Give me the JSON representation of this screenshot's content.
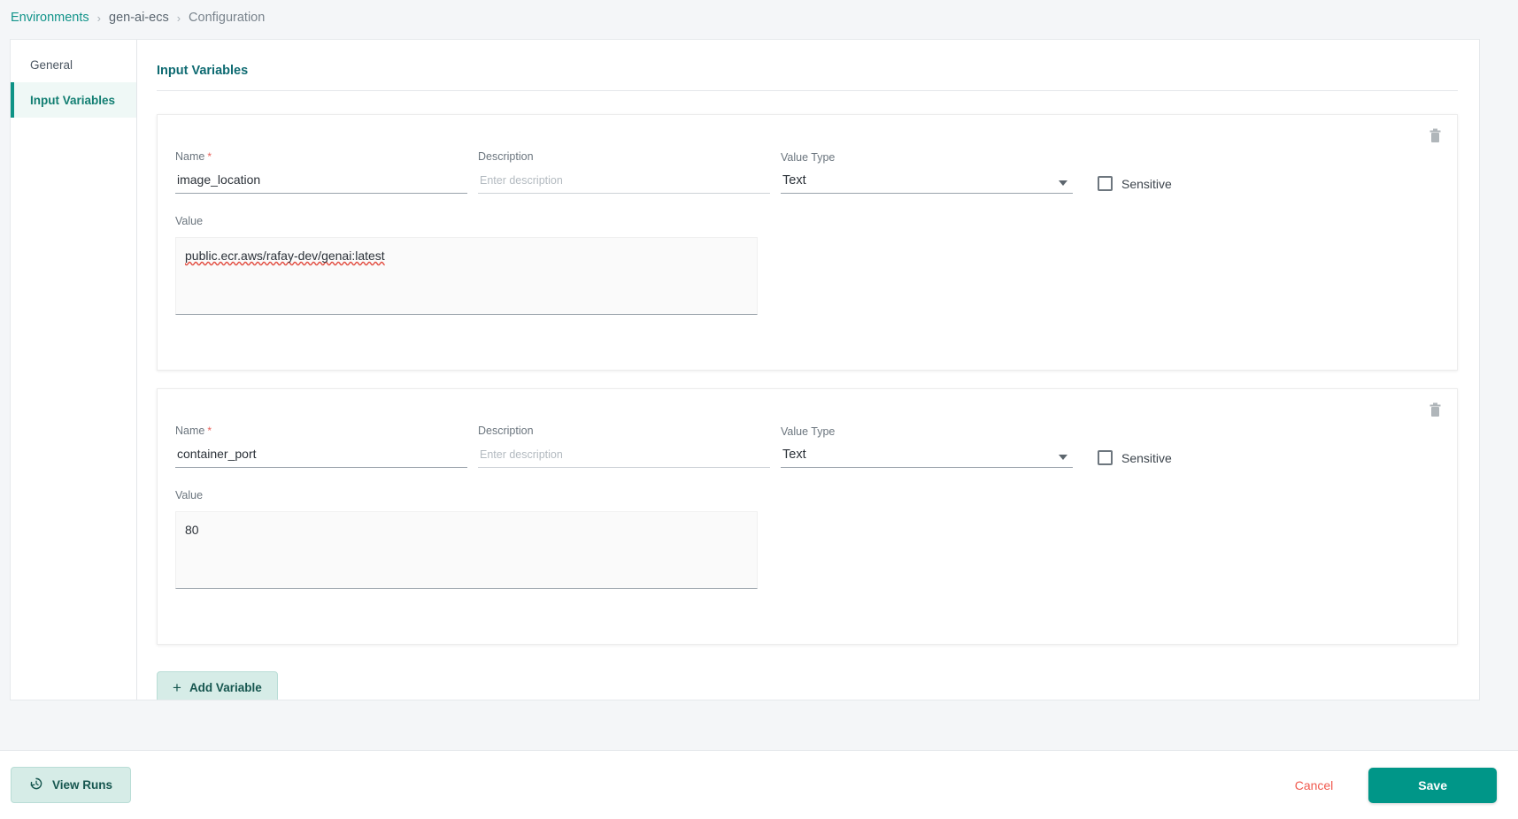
{
  "breadcrumb": {
    "items": [
      {
        "label": "Environments",
        "type": "link"
      },
      {
        "label": "gen-ai-ecs",
        "type": "mid"
      },
      {
        "label": "Configuration",
        "type": "current"
      }
    ],
    "separator": "›"
  },
  "sidebar": {
    "items": [
      {
        "label": "General",
        "active": false
      },
      {
        "label": "Input Variables",
        "active": true
      }
    ]
  },
  "main": {
    "section_title": "Input Variables",
    "labels": {
      "name": "Name",
      "required_mark": "*",
      "description": "Description",
      "description_placeholder": "Enter description",
      "value_type": "Value Type",
      "sensitive": "Sensitive",
      "value": "Value"
    },
    "variables": [
      {
        "name": "image_location",
        "description": "",
        "value_type": "Text",
        "sensitive": false,
        "value": "public.ecr.aws/rafay-dev/genai:latest"
      },
      {
        "name": "container_port",
        "description": "",
        "value_type": "Text",
        "sensitive": false,
        "value": "80"
      }
    ],
    "add_variable_label": "Add Variable",
    "add_variable_icon": "plus-icon",
    "delete_icon": "trash-icon"
  },
  "footer": {
    "view_runs_label": "View Runs",
    "view_runs_icon": "history-icon",
    "cancel_label": "Cancel",
    "save_label": "Save"
  },
  "colors": {
    "accent_teal": "#009688",
    "nav_active": "#0e9386",
    "section_title": "#0f6b72",
    "cancel_red": "#f05a4f",
    "required_red": "#e8605a",
    "page_bg": "#f4f6f8"
  }
}
